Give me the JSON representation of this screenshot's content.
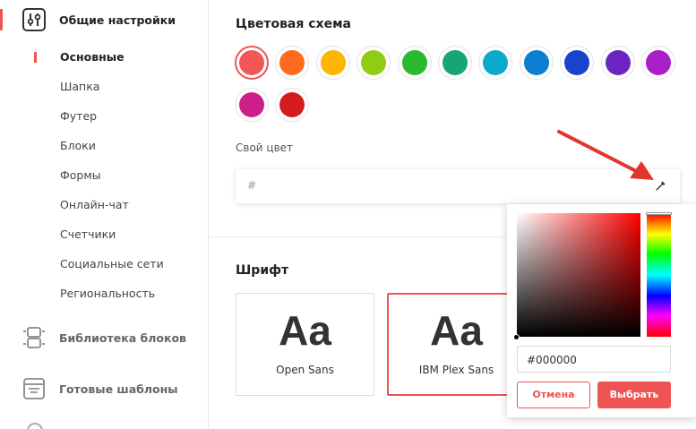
{
  "sidebar": {
    "general": {
      "label": "Общие настройки"
    },
    "sub_items": [
      {
        "label": "Основные"
      },
      {
        "label": "Шапка"
      },
      {
        "label": "Футер"
      },
      {
        "label": "Блоки"
      },
      {
        "label": "Формы"
      },
      {
        "label": "Онлайн-чат"
      },
      {
        "label": "Счетчики"
      },
      {
        "label": "Социальные сети"
      },
      {
        "label": "Региональность"
      }
    ],
    "library": {
      "label": "Библиотека блоков"
    },
    "templates": {
      "label": "Готовые шаблоны"
    }
  },
  "color_scheme": {
    "title": "Цветовая схема",
    "swatches": [
      "#f25656",
      "#ff6a1f",
      "#ffb400",
      "#8fcc14",
      "#2ab82c",
      "#17a673",
      "#0aaacc",
      "#0a7ed1",
      "#1a43cc",
      "#6b24c2",
      "#a91fc9",
      "#cc1f8a",
      "#d41c1c"
    ],
    "selected_index": 0,
    "own_label": "Свой цвет",
    "own_placeholder": "#"
  },
  "font": {
    "title": "Шрифт",
    "cards": [
      {
        "sample": "Aa",
        "name": "Open Sans"
      },
      {
        "sample": "Aa",
        "name": "IBM Plex Sans"
      }
    ]
  },
  "picker": {
    "hex_value": "#000000",
    "cancel_label": "Отмена",
    "select_label": "Выбрать"
  },
  "colors": {
    "accent": "#ee5454"
  }
}
